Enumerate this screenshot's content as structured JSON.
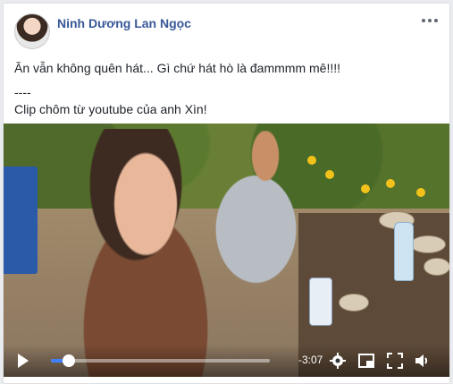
{
  "post": {
    "author": "Ninh Dương Lan Ngọc",
    "text_line1": "Ăn vẫn không quên hát... Gì chứ hát hò là đammmm mê!!!!",
    "separator": "----",
    "text_line2": "Clip chôm từ youtube của anh Xìn!"
  },
  "video": {
    "remaining_time": "-3:07",
    "progress_fraction": 0.08
  },
  "icons": {
    "more": "more-horizontal-icon",
    "play": "play-icon",
    "settings": "gear-icon",
    "pip": "picture-in-picture-icon",
    "fullscreen": "fullscreen-icon",
    "volume": "volume-icon"
  },
  "colors": {
    "author_link": "#385898",
    "progress_fill": "#4080ff",
    "text": "#1d2129"
  }
}
